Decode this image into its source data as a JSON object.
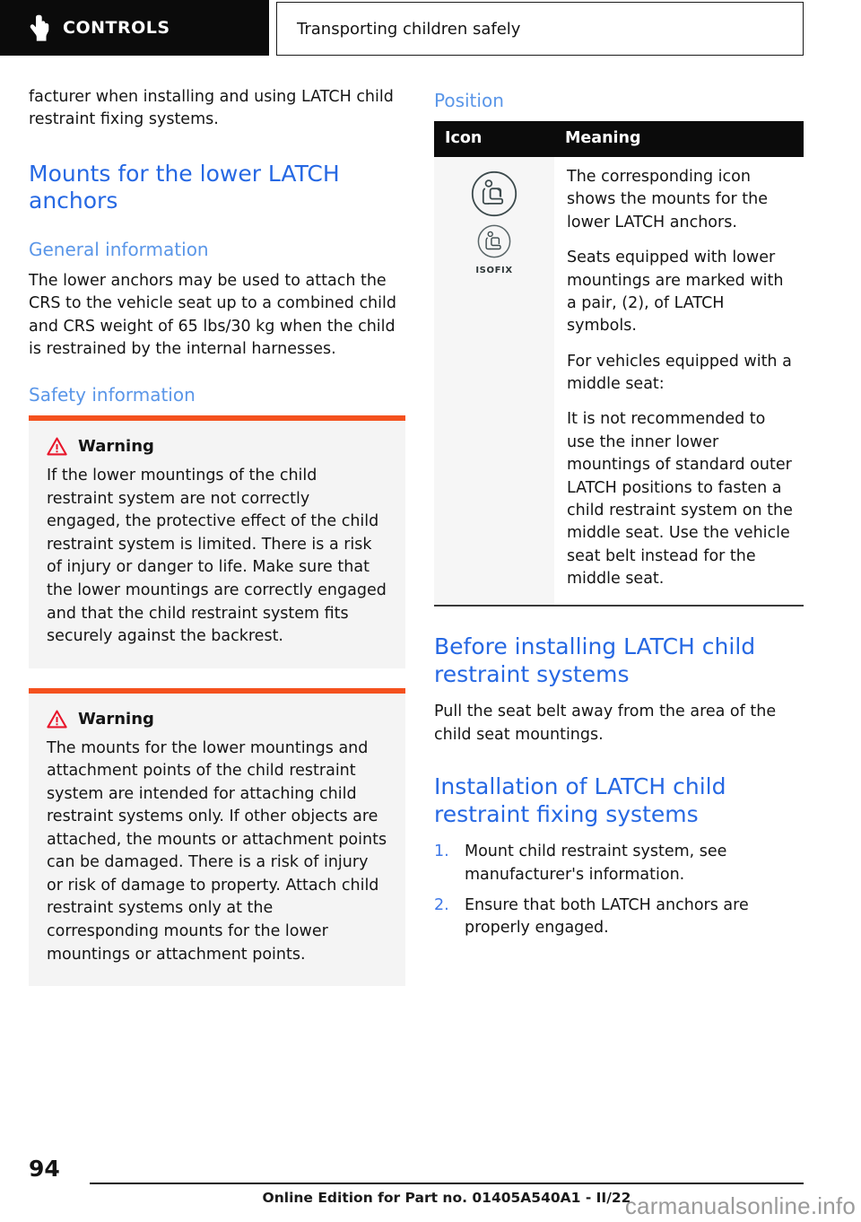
{
  "header": {
    "tab_label": "CONTROLS",
    "tab_icon": "pointing-hand-icon",
    "title": "Transporting children safely"
  },
  "left_column": {
    "continued_paragraph": "facturer when installing and using LATCH child restraint fixing systems.",
    "section_heading": "Mounts for the lower LATCH anchors",
    "general_information": {
      "heading": "General information",
      "paragraph": "The lower anchors may be used to attach the CRS to the vehicle seat up to a combined child and CRS weight of 65 lbs/30 kg when the child is restrained by the internal harnesses."
    },
    "safety_information": {
      "heading": "Safety information",
      "warnings": [
        {
          "icon": "warning-triangle-icon",
          "title": "Warning",
          "text": "If the lower mountings of the child restraint system are not correctly engaged, the protective effect of the child restraint system is limited. There is a risk of injury or danger to life. Make sure that the lower mountings are correctly engaged and that the child restraint system fits securely against the backrest."
        },
        {
          "icon": "warning-triangle-icon",
          "title": "Warning",
          "text": "The mounts for the lower mountings and attachment points of the child restraint system are intended for attaching child restraint systems only. If other objects are attached, the mounts or attachment points can be damaged. There is a risk of injury or risk of damage to property. Attach child restraint systems only at the corresponding mounts for the lower mountings or attachment points."
        }
      ]
    }
  },
  "right_column": {
    "position": {
      "heading": "Position",
      "table": {
        "columns": [
          "Icon",
          "Meaning"
        ],
        "rows": [
          {
            "icons": [
              {
                "name": "child-seat-icon-large",
                "label": ""
              },
              {
                "name": "child-seat-isofix-icon",
                "label": "ISOFIX"
              }
            ],
            "meaning": [
              "The corresponding icon shows the mounts for the lower LATCH anchors.",
              "Seats equipped with lower mountings are marked with a pair, (2), of LATCH symbols.",
              "For vehicles equipped with a middle seat:",
              "It is not recommended to use the inner lower mountings of standard outer LATCH positions to fasten a child restraint system on the middle seat. Use the vehicle seat belt instead for the middle seat."
            ]
          }
        ]
      }
    },
    "before_installing": {
      "heading": "Before installing LATCH child restraint systems",
      "paragraph": "Pull the seat belt away from the area of the child seat mountings."
    },
    "installation": {
      "heading": "Installation of LATCH child restraint fixing systems",
      "steps": [
        "Mount child restraint system, see manufacturer's information.",
        "Ensure that both LATCH anchors are properly engaged."
      ]
    }
  },
  "footer": {
    "page_number": "94",
    "edition_text": "Online Edition for Part no. 01405A540A1 - II/22",
    "watermark": "carmanualsonline.info"
  },
  "colors": {
    "heading_blue": "#2668E3",
    "subheading_blue": "#5A96E8",
    "warning_bar_orange": "#F4511E",
    "warning_triangle_red": "#E8152A",
    "header_black": "#0b0b0b",
    "list_number_blue": "#3F79E8"
  }
}
